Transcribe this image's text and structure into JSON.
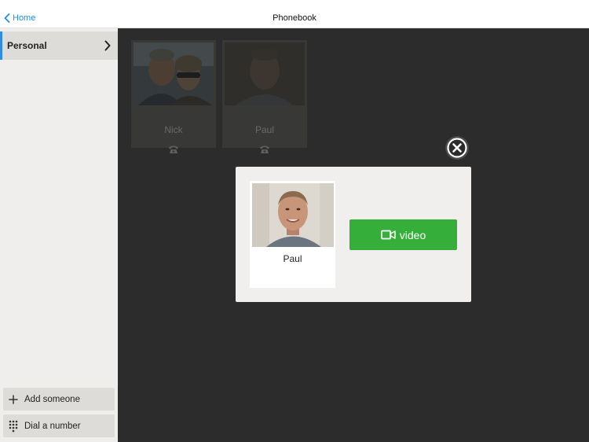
{
  "header": {
    "back_label": "Home",
    "title": "Phonebook"
  },
  "sidebar": {
    "items": [
      {
        "label": "Personal",
        "icon": "chevron-right-icon",
        "selected": true
      }
    ],
    "actions": [
      {
        "label": "Add someone",
        "icon": "plus-icon"
      },
      {
        "label": "Dial a number",
        "icon": "dialpad-icon"
      }
    ]
  },
  "contacts": [
    {
      "name": "Nick",
      "icon": "phone-icon"
    },
    {
      "name": "Paul",
      "icon": "phone-icon"
    }
  ],
  "modal": {
    "contact_name": "Paul",
    "video_label": "video",
    "video_icon": "video-camera-icon",
    "close_icon": "close-circle-icon"
  },
  "colors": {
    "accent": "#2e8ce3",
    "link": "#1a8fe3",
    "video_button": "#36ae3a",
    "main_background": "#2c2c2c",
    "sidebar_background": "#f0eeec"
  }
}
